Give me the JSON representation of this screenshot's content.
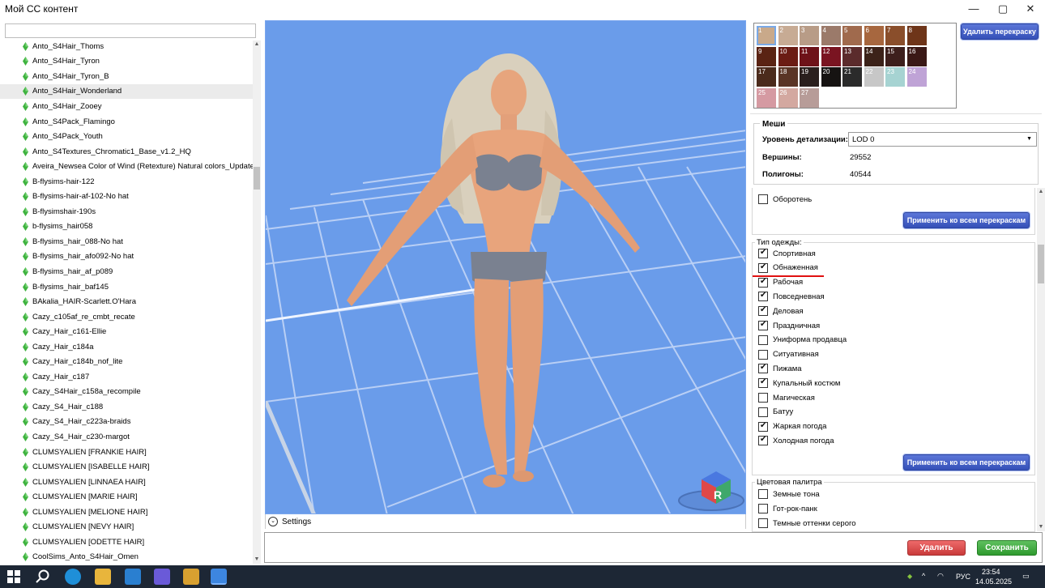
{
  "window": {
    "title": "Мой СС контент",
    "minimize": "—",
    "maximize": "▢",
    "close": "✕"
  },
  "search": {
    "value": "",
    "placeholder": ""
  },
  "list": {
    "items": [
      "Anto_S4Hair_Thoms",
      "Anto_S4Hair_Tyron",
      "Anto_S4Hair_Tyron_B",
      "Anto_S4Hair_Wonderland",
      "Anto_S4Hair_Zooey",
      "Anto_S4Pack_Flamingo",
      "Anto_S4Pack_Youth",
      "Anto_S4Textures_Chromatic1_Base_v1.2_HQ",
      "Aveira_Newsea Color of Wind (Retexture) Natural colors_Updated",
      "B-flysims-hair-122",
      "B-flysims-hair-af-102-No hat",
      "B-flysimshair-190s",
      "b-flysims_hair058",
      "B-flysims_hair_088-No hat",
      "B-flysims_hair_afo092-No hat",
      "B-flysims_hair_af_p089",
      "B-flysims_hair_baf145",
      "BAkalia_HAIR-Scarlett.O'Hara",
      "Cazy_c105af_re_cmbt_recate",
      "Cazy_Hair_c161-Ellie",
      "Cazy_Hair_c184a",
      "Cazy_Hair_c184b_nof_lite",
      "Cazy_Hair_c187",
      "Cazy_S4Hair_c158a_recompile",
      "Cazy_S4_Hair_c188",
      "Cazy_S4_Hair_c223a-braids",
      "Cazy_S4_Hair_c230-margot",
      "CLUMSYALIEN [FRANKIE HAIR]",
      "CLUMSYALIEN [ISABELLE HAIR]",
      "CLUMSYALIEN [LINNAEA HAIR]",
      "CLUMSYALIEN [MARIE HAIR]",
      "CLUMSYALIEN [MELIONE HAIR]",
      "CLUMSYALIEN [NEVY HAIR]",
      "CLUMSYALIEN [ODETTE HAIR]",
      "CoolSims_Anto_S4Hair_Omen"
    ],
    "selected_index": 3,
    "icon": "plumbob-icon",
    "icon_color": "#3fb33f"
  },
  "viewport": {
    "background": "#6a9cea",
    "gizmo_letter": "R",
    "settings_label": "Settings"
  },
  "swatches": {
    "items": [
      {
        "n": "1",
        "c": "#c9a98a"
      },
      {
        "n": "2",
        "c": "#c7ab94"
      },
      {
        "n": "3",
        "c": "#b89c87"
      },
      {
        "n": "4",
        "c": "#9b7a6a"
      },
      {
        "n": "5",
        "c": "#a06a4d"
      },
      {
        "n": "6",
        "c": "#a7673f"
      },
      {
        "n": "7",
        "c": "#8a4e2b"
      },
      {
        "n": "8",
        "c": "#6e3519"
      },
      {
        "n": "9",
        "c": "#5a2313"
      },
      {
        "n": "10",
        "c": "#6b1c14"
      },
      {
        "n": "11",
        "c": "#6e1219"
      },
      {
        "n": "12",
        "c": "#7a1421"
      },
      {
        "n": "13",
        "c": "#5b2b2c"
      },
      {
        "n": "14",
        "c": "#3c2219"
      },
      {
        "n": "15",
        "c": "#3d1f1c"
      },
      {
        "n": "16",
        "c": "#3a1916"
      },
      {
        "n": "17",
        "c": "#4b2b1c"
      },
      {
        "n": "18",
        "c": "#5a3526"
      },
      {
        "n": "19",
        "c": "#2a1f1d"
      },
      {
        "n": "20",
        "c": "#161312"
      },
      {
        "n": "21",
        "c": "#2b2b2b"
      },
      {
        "n": "22",
        "c": "#c7c7c7"
      },
      {
        "n": "23",
        "c": "#a6d3d2"
      },
      {
        "n": "24",
        "c": "#bfa3d6"
      },
      {
        "n": "25",
        "c": "#d59aa2"
      },
      {
        "n": "26",
        "c": "#d3a8a0"
      },
      {
        "n": "27",
        "c": "#b79c98"
      }
    ],
    "selected": "1",
    "delete_button": "Удалить перекраску"
  },
  "mesh": {
    "legend": "Меши",
    "lod_label": "Уровень детализации:",
    "lod_value": "LOD 0",
    "vertices_label": "Вершины:",
    "vertices_value": "29552",
    "polygons_label": "Полигоны:",
    "polygons_value": "40544"
  },
  "werewolf": {
    "label": "Оборотень",
    "checked": false
  },
  "apply_button": "Применить ко всем перекраскам",
  "clothing": {
    "legend": "Тип одежды:",
    "items": [
      {
        "label": "Спортивная",
        "checked": true
      },
      {
        "label": "Обнаженная",
        "checked": true
      },
      {
        "label": "Рабочая",
        "checked": true
      },
      {
        "label": "Повседневная",
        "checked": true
      },
      {
        "label": "Деловая",
        "checked": true
      },
      {
        "label": "Праздничная",
        "checked": true
      },
      {
        "label": "Униформа продавца",
        "checked": false
      },
      {
        "label": "Ситуативная",
        "checked": false
      },
      {
        "label": "Пижама",
        "checked": true
      },
      {
        "label": "Купальный костюм",
        "checked": true
      },
      {
        "label": "Магическая",
        "checked": false
      },
      {
        "label": "Батуу",
        "checked": false
      },
      {
        "label": "Жаркая погода",
        "checked": true
      },
      {
        "label": "Холодная погода",
        "checked": true
      }
    ],
    "underline_color": "#e01010"
  },
  "palette": {
    "legend": "Цветовая палитра",
    "items": [
      {
        "label": "Земные тона",
        "checked": false
      },
      {
        "label": "Гот-рок-панк",
        "checked": false
      },
      {
        "label": "Темные оттенки серого",
        "checked": false
      }
    ]
  },
  "actions": {
    "delete": "Удалить",
    "save": "Сохранить"
  },
  "taskbar": {
    "lang": "РУС",
    "time": "23:54",
    "date": "14.05.2025"
  }
}
